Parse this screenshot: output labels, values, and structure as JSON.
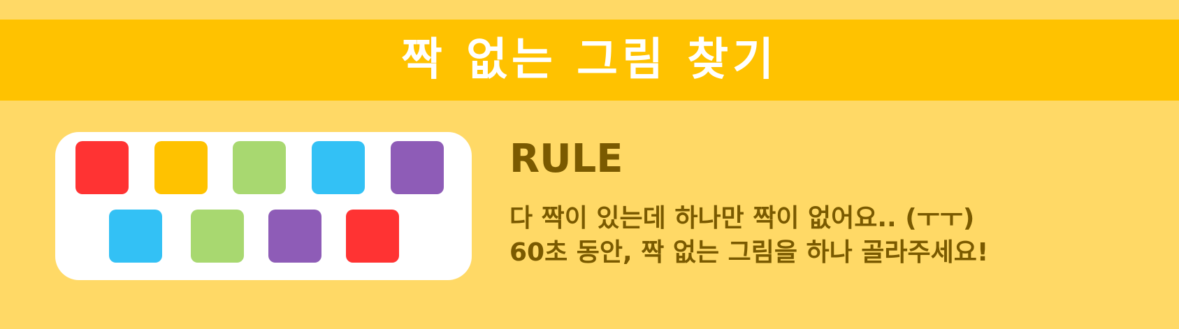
{
  "header": {
    "title": "짝 없는 그림 찾기"
  },
  "rules": {
    "heading": "RULE",
    "line1": "다 짝이 있는데 하나만 짝이 없어요.. (ㅜㅜ)",
    "line2": "60초 동안, 짝 없는 그림을 하나 골라주세요!"
  },
  "preview": {
    "row1": [
      "red",
      "yellow",
      "green",
      "blue",
      "purple"
    ],
    "row2": [
      "blue",
      "green",
      "purple",
      "red"
    ]
  },
  "colors": {
    "background": "#ffd966",
    "banner": "#ffc200",
    "text": "#7a5a00",
    "red": "#ff3333",
    "yellow": "#ffc200",
    "green": "#a8d870",
    "blue": "#33c1f5",
    "purple": "#8e5cb7"
  }
}
